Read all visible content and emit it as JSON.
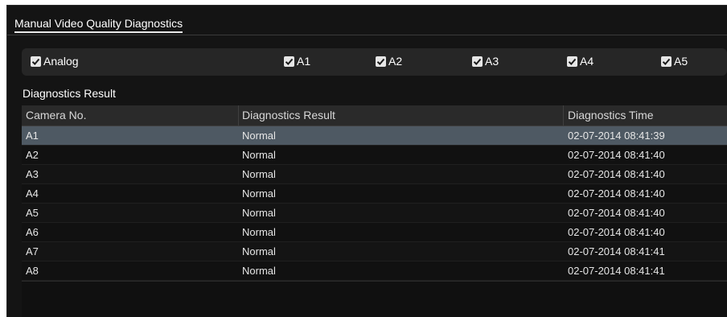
{
  "window": {
    "tab_label": "Manual Video Quality Diagnostics"
  },
  "channels": {
    "analog": {
      "label": "Analog",
      "checked": true
    },
    "items": [
      {
        "label": "A1",
        "checked": true
      },
      {
        "label": "A2",
        "checked": true
      },
      {
        "label": "A3",
        "checked": true
      },
      {
        "label": "A4",
        "checked": true
      },
      {
        "label": "A5",
        "checked": true
      }
    ]
  },
  "results": {
    "section_title": "Diagnostics Result",
    "columns": [
      "Camera No.",
      "Diagnostics Result",
      "Diagnostics Time"
    ],
    "rows": [
      {
        "camera": "A1",
        "result": "Normal",
        "time": "02-07-2014 08:41:39",
        "selected": true
      },
      {
        "camera": "A2",
        "result": "Normal",
        "time": "02-07-2014 08:41:40"
      },
      {
        "camera": "A3",
        "result": "Normal",
        "time": "02-07-2014 08:41:40"
      },
      {
        "camera": "A4",
        "result": "Normal",
        "time": "02-07-2014 08:41:40"
      },
      {
        "camera": "A5",
        "result": "Normal",
        "time": "02-07-2014 08:41:40"
      },
      {
        "camera": "A6",
        "result": "Normal",
        "time": "02-07-2014 08:41:40"
      },
      {
        "camera": "A7",
        "result": "Normal",
        "time": "02-07-2014 08:41:41"
      },
      {
        "camera": "A8",
        "result": "Normal",
        "time": "02-07-2014 08:41:41"
      }
    ]
  },
  "colors": {
    "background": "#141414",
    "selected_row": "#4e5963",
    "checkbox_row": "#262626"
  },
  "icons": {
    "checkbox": "checkmark-icon"
  }
}
